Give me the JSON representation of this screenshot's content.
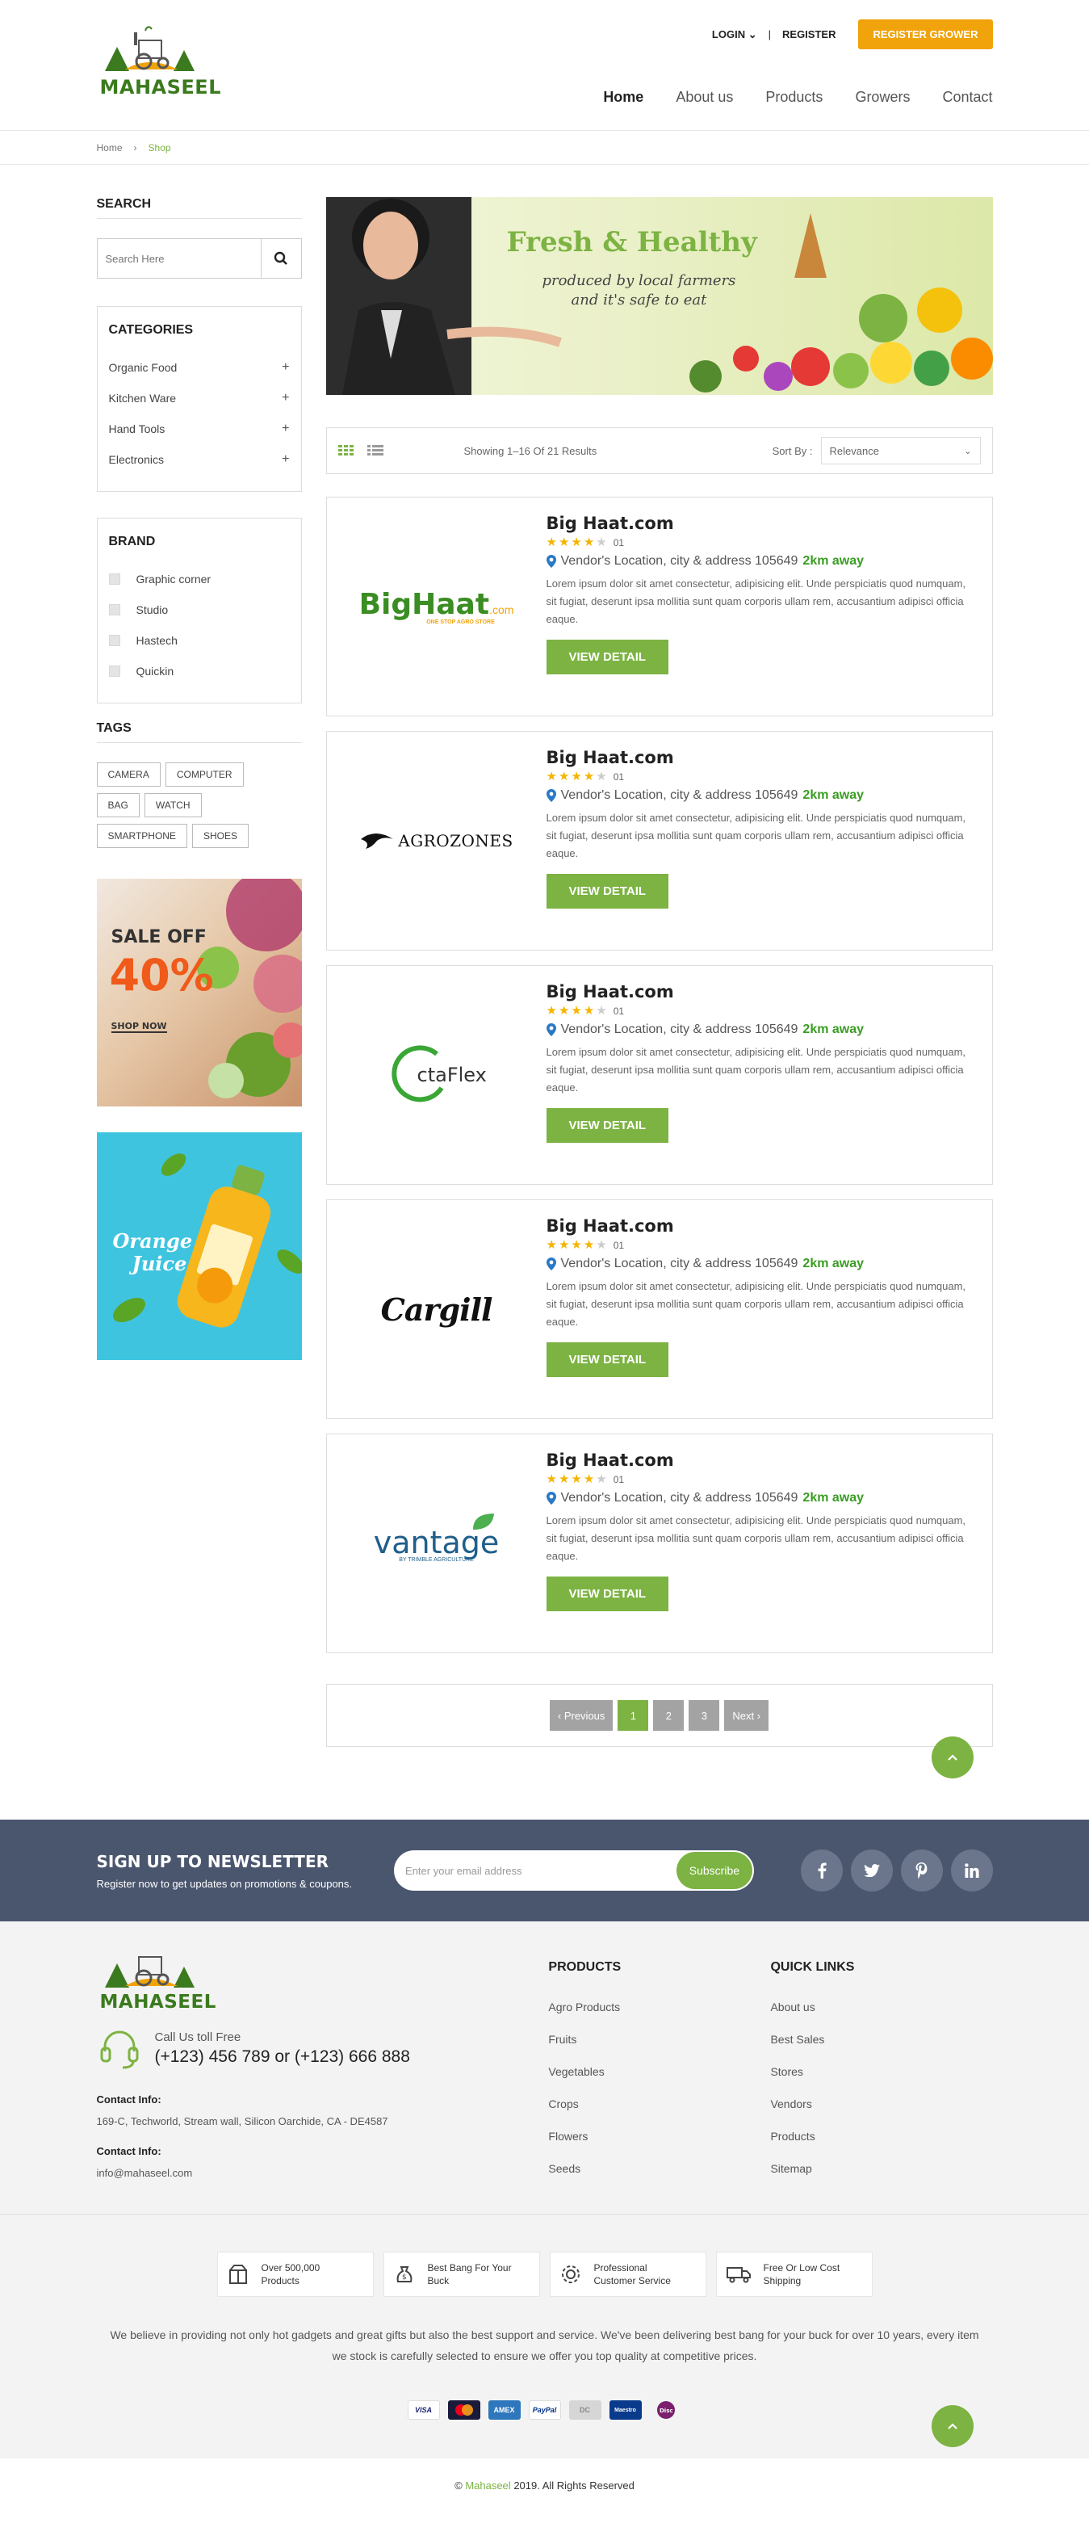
{
  "header": {
    "logo_text": "MAHASEEL",
    "login": "LOGIN",
    "separator": "|",
    "register": "REGISTER",
    "register_grower": "REGISTER GROWER",
    "nav": [
      "Home",
      "About us",
      "Products",
      "Growers",
      "Contact"
    ]
  },
  "breadcrumb": {
    "home": "Home",
    "current": "Shop"
  },
  "sidebar": {
    "search_title": "SEARCH",
    "search_placeholder": "Search Here",
    "categories_title": "CATEGORIES",
    "categories": [
      "Organic Food",
      "Kitchen Ware",
      "Hand Tools",
      "Electronics"
    ],
    "brand_title": "BRAND",
    "brands": [
      "Graphic corner",
      "Studio",
      "Hastech",
      "Quickin"
    ],
    "tags_title": "TAGS",
    "tags": [
      "CAMERA",
      "COMPUTER",
      "BAG",
      "WATCH",
      "SMARTPHONE",
      "SHOES"
    ],
    "promo1": {
      "line1": "SALE OFF",
      "line2": "40%",
      "line3": "SHOP NOW"
    },
    "promo2": {
      "line1": "Orange",
      "line2": "Juice"
    }
  },
  "banner": {
    "heading": "Fresh & Healthy",
    "sub1": "produced by local farmers",
    "sub2": "and it's safe to eat"
  },
  "toolbar": {
    "showing": "Showing 1–16 Of 21 Results",
    "sort_label": "Sort By :",
    "sort_value": "Relevance"
  },
  "vendors": [
    {
      "logo": "BigHaat",
      "logo_suffix": ".com",
      "logo_tag": "ONE STOP AGRO STORE",
      "name": "Big Haat.com",
      "rating": 4,
      "count": "01",
      "location": "Vendor's Location, city & address 105649",
      "away": "2km away",
      "desc": "Lorem ipsum dolor sit amet consectetur, adipisicing elit. Unde perspiciatis quod numquam, sit fugiat, deserunt ipsa mollitia sunt quam corporis ullam rem, accusantium adipisci officia eaque.",
      "button": "VIEW DETAIL"
    },
    {
      "logo": "AGROZONES",
      "name": "Big Haat.com",
      "rating": 4,
      "count": "01",
      "location": "Vendor's Location, city & address 105649",
      "away": "2km away",
      "desc": "Lorem ipsum dolor sit amet consectetur, adipisicing elit. Unde perspiciatis quod numquam, sit fugiat, deserunt ipsa mollitia sunt quam corporis ullam rem, accusantium adipisci officia eaque.",
      "button": "VIEW DETAIL"
    },
    {
      "logo": "ctaFlex",
      "name": "Big Haat.com",
      "rating": 4,
      "count": "01",
      "location": "Vendor's Location, city & address 105649",
      "away": "2km away",
      "desc": "Lorem ipsum dolor sit amet consectetur, adipisicing elit. Unde perspiciatis quod numquam, sit fugiat, deserunt ipsa mollitia sunt quam corporis ullam rem, accusantium adipisci officia eaque.",
      "button": "VIEW DETAIL"
    },
    {
      "logo": "Cargill",
      "name": "Big Haat.com",
      "rating": 4,
      "count": "01",
      "location": "Vendor's Location, city & address 105649",
      "away": "2km away",
      "desc": "Lorem ipsum dolor sit amet consectetur, adipisicing elit. Unde perspiciatis quod numquam, sit fugiat, deserunt ipsa mollitia sunt quam corporis ullam rem, accusantium adipisci officia eaque.",
      "button": "VIEW DETAIL"
    },
    {
      "logo": "vantage",
      "logo_tag": "BY TRIMBLE AGRICULTURE",
      "name": "Big Haat.com",
      "rating": 4,
      "count": "01",
      "location": "Vendor's Location, city & address 105649",
      "away": "2km away",
      "desc": "Lorem ipsum dolor sit amet consectetur, adipisicing elit. Unde perspiciatis quod numquam, sit fugiat, deserunt ipsa mollitia sunt quam corporis ullam rem, accusantium adipisci officia eaque.",
      "button": "VIEW DETAIL"
    }
  ],
  "pagination": {
    "prev": "‹ Previous",
    "pages": [
      "1",
      "2",
      "3"
    ],
    "next": "Next ›",
    "active": "1"
  },
  "newsletter": {
    "title": "SIGN UP TO NEWSLETTER",
    "subtitle": "Register now to get updates on promotions & coupons.",
    "placeholder": "Enter your email address",
    "button": "Subscribe",
    "socials": [
      "facebook-icon",
      "twitter-icon",
      "pinterest-icon",
      "linkedin-icon"
    ]
  },
  "footer": {
    "logo_text": "MAHASEEL",
    "call_label": "Call Us toll Free",
    "phone": "(+123) 456 789 or (+123) 666 888",
    "contact_label1": "Contact Info:",
    "address": "169-C, Techworld, Stream wall, Silicon Oarchide, CA - DE4587",
    "contact_label2": "Contact Info:",
    "email": "info@mahaseel.com",
    "products_title": "PRODUCTS",
    "products": [
      "Agro Products",
      "Fruits",
      "Vegetables",
      "Crops",
      "Flowers",
      "Seeds"
    ],
    "quick_title": "QUICK LINKS",
    "quick": [
      "About us",
      "Best Sales",
      "Stores",
      "Vendors",
      "Products",
      "Sitemap"
    ],
    "features": [
      {
        "l1": "Over 500,000",
        "l2": "Products"
      },
      {
        "l1": "Best Bang For Your",
        "l2": "Buck"
      },
      {
        "l1": "Professional",
        "l2": "Customer Service"
      },
      {
        "l1": "Free Or Low Cost",
        "l2": "Shipping"
      }
    ],
    "about": "We believe in providing not only hot gadgets and great gifts but also the best support and service. We've been delivering best bang for your buck for over 10 years, every item we stock is carefully selected to ensure we offer you top quality at competitive prices.",
    "payments": [
      "VISA",
      "MC",
      "AMEX",
      "PayPal",
      "DC",
      "Maestro",
      "Disc"
    ],
    "copy_pre": "©",
    "copy_brand": "Mahaseel",
    "copy_post": "2019. All Rights Reserved"
  },
  "colors": {
    "accent": "#7cb342",
    "orange": "#f0a30a",
    "newsletter_bg": "#4a566e",
    "footer_bg": "#f3f3f3"
  }
}
